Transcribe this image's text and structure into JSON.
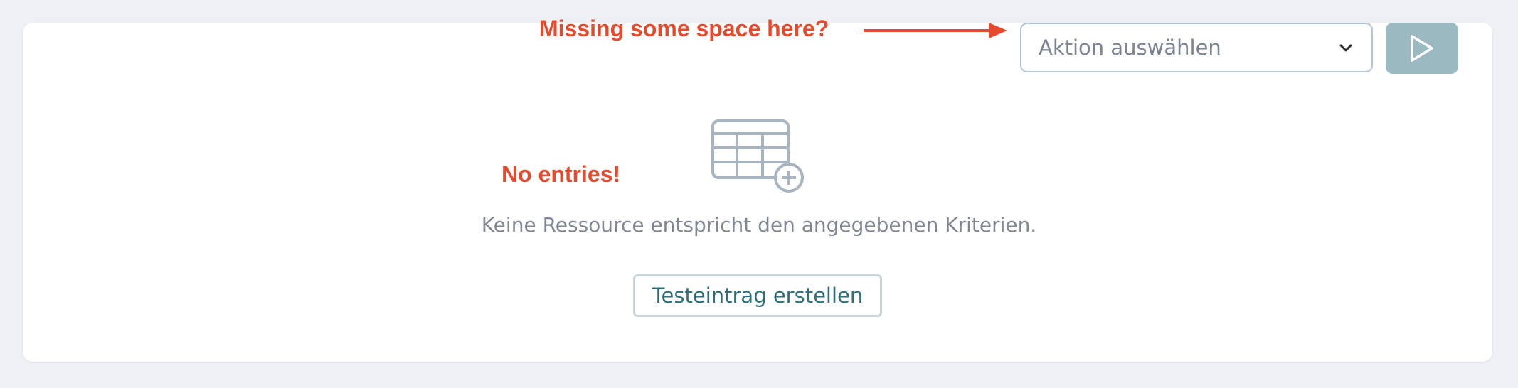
{
  "annotations": {
    "top": "Missing some space here?",
    "left": "No entries!"
  },
  "action_select": {
    "value": "Aktion auswählen"
  },
  "run_button": {
    "icon": "play-icon"
  },
  "empty_state": {
    "icon": "table-add-icon",
    "message": "Keine Ressource entspricht den angegebenen Kriterien.",
    "create_button_label": "Testeintrag erstellen"
  },
  "colors": {
    "annotation": "#e64a2e",
    "run_button": "#9ab9c1",
    "create_button_text": "#2f6f78",
    "icon_stroke": "#a9b4c1",
    "background": "#eef0f4"
  }
}
